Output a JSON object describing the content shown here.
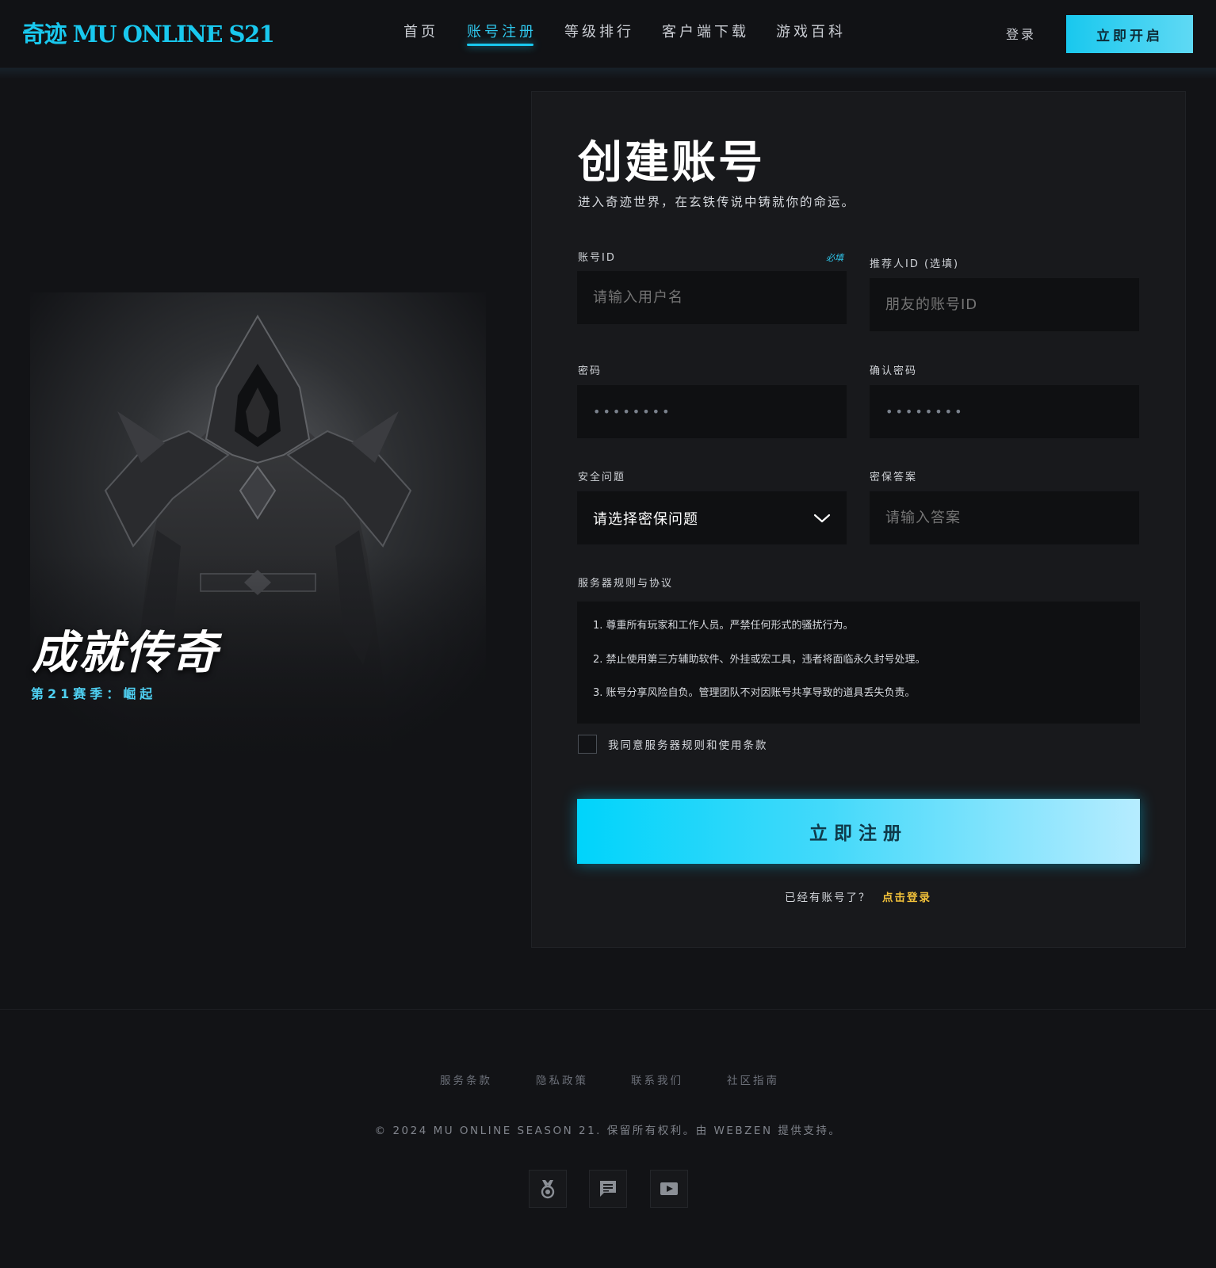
{
  "header": {
    "logo": "奇迹 MU ONLINE S21",
    "nav": [
      {
        "label": "首页"
      },
      {
        "label": "账号注册"
      },
      {
        "label": "等级排行"
      },
      {
        "label": "客户端下载"
      },
      {
        "label": "游戏百科"
      }
    ],
    "active_nav": "账号注册",
    "login_label": "登录",
    "start_button": "立即开启"
  },
  "hero": {
    "title": "成就传奇",
    "subtitle": "第21赛季：崛起"
  },
  "form": {
    "title": "创建账号",
    "description": "进入奇迹世界，在玄铁传说中铸就你的命运。",
    "account_id": {
      "label": "账号ID",
      "required_tag": "必填",
      "placeholder": "请输入用户名"
    },
    "referrer_id": {
      "label": "推荐人ID (选填)",
      "placeholder": "朋友的账号ID"
    },
    "password": {
      "label": "密码",
      "value": "••••••••"
    },
    "confirm_password": {
      "label": "确认密码",
      "value": "••••••••"
    },
    "security_question": {
      "label": "安全问题",
      "selected": "请选择密保问题"
    },
    "security_answer": {
      "label": "密保答案",
      "placeholder": "请输入答案"
    },
    "rules": {
      "label": "服务器规则与协议",
      "items": [
        "1. 尊重所有玩家和工作人员。严禁任何形式的骚扰行为。",
        "2. 禁止使用第三方辅助软件、外挂或宏工具，违者将面临永久封号处理。",
        "3. 账号分享风险自负。管理团队不对因账号共享导致的道具丢失负责。"
      ]
    },
    "agree_label": "我同意服务器规则和使用条款",
    "submit_label": "立即注册",
    "have_account": "已经有账号了？",
    "login_link": "点击登录"
  },
  "footer": {
    "links": [
      "服务条款",
      "隐私政策",
      "联系我们",
      "社区指南"
    ],
    "copyright": "© 2024 MU ONLINE SEASON 21. 保留所有权利。由 WEBZEN 提供支持。",
    "social_icons": [
      "medal-icon",
      "chat-icon",
      "video-icon"
    ]
  },
  "colors": {
    "accent": "#19c8ee",
    "gold": "#f3c23a",
    "background": "#121316",
    "card": "#18191c",
    "input": "#0f1012"
  }
}
